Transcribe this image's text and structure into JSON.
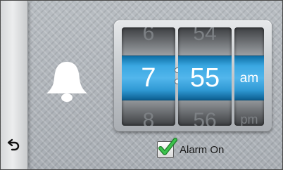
{
  "alarm": {
    "hour": {
      "previous": "6",
      "current": "7",
      "next": "8"
    },
    "minute": {
      "previous": "54",
      "current": "55",
      "next": "56"
    },
    "meridiem": {
      "previous": "",
      "current": "am",
      "next": "pm"
    },
    "enabled": true,
    "toggle_label": "Alarm On"
  },
  "colors": {
    "accent": "#3aa7e1",
    "check": "#2aa63a"
  }
}
